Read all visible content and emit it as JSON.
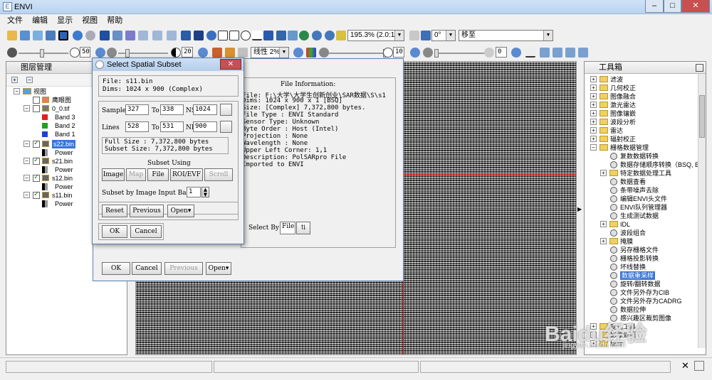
{
  "window": {
    "title": "ENVI",
    "min": "–",
    "max": "□",
    "close": "✕"
  },
  "menu": [
    "文件",
    "编辑",
    "显示",
    "视图",
    "帮助"
  ],
  "toolbar": {
    "zoom": "195.3% (2.0:1)",
    "angle": "0°",
    "mode": "移至",
    "stretch": "线性 2%",
    "v1": "50",
    "v2": "20",
    "v3": "10",
    "v4": "0"
  },
  "layers": {
    "title": "图层管理",
    "root": "视图",
    "overview": "鹰眼图",
    "file1": "0_0.tif",
    "band3": "Band 3",
    "band2": "Band 2",
    "band1": "Band 1",
    "files": [
      {
        "name": "s22.bin",
        "sub": "Power"
      },
      {
        "name": "s21.bin",
        "sub": "Power"
      },
      {
        "name": "s12.bin",
        "sub": "Power"
      },
      {
        "name": "s11.bin",
        "sub": "Power"
      }
    ]
  },
  "fileinfo": {
    "title": "File Information:",
    "lines": [
      "File: F:\\大学\\大学生创新创业\\SAR数据\\S\\s1",
      "Dims: 1024 x 900 x 1 [BSQ]",
      "Size: [Complex] 7,372,800 bytes.",
      "File Type  : ENVI Standard",
      "Sensor Type: Unknown",
      "Byte Order : Host (Intel)",
      "Projection : None",
      "Wavelength : None",
      "Upper Left Corner: 1,1",
      "Description: PolSARpro File",
      "Imported to ENVI"
    ],
    "selectby": "Select By",
    "file": "File",
    "ok": "OK",
    "cancel": "Cancel",
    "previous": "Previous",
    "open": "Open"
  },
  "dialog": {
    "title": "Select Spatial Subset",
    "info1": "File: s11.bin",
    "info2": "Dims: 1024 x 900 (Complex)",
    "samples": "Samples",
    "to": "To",
    "ns": "NS",
    "lines": "Lines",
    "nl": "NL",
    "s_from": "327",
    "s_to": "338",
    "s_ns": "1024",
    "l_from": "528",
    "l_to": "531",
    "l_nl": "900",
    "fullsize": "Full Size  : 7,372,800 bytes",
    "subsize": "Subset Size: 7,372,800 bytes",
    "subsetusing": "Subset Using",
    "image": "Image",
    "map": "Map",
    "file": "File",
    "roi": "ROI/EVF",
    "scroll": "Scroll",
    "byband": "Subset by Image Input Band",
    "band": "1",
    "reset": "Reset",
    "previous": "Previous",
    "open": "Open",
    "ok": "OK",
    "cancel": "Cancel"
  },
  "toolbox": {
    "title": "工具箱",
    "items": [
      {
        "t": "滤波",
        "k": "folder",
        "l": 0
      },
      {
        "t": "几何校正",
        "k": "folder",
        "l": 0
      },
      {
        "t": "图像融合",
        "k": "folder",
        "l": 0
      },
      {
        "t": "激光雷达",
        "k": "folder",
        "l": 0
      },
      {
        "t": "图像镶嵌",
        "k": "folder",
        "l": 0
      },
      {
        "t": "波段分析",
        "k": "folder",
        "l": 0
      },
      {
        "t": "雷达",
        "k": "folder",
        "l": 0
      },
      {
        "t": "辐射校正",
        "k": "folder",
        "l": 0
      },
      {
        "t": "栅格数据管理",
        "k": "folder",
        "l": 0,
        "open": true
      },
      {
        "t": "复数数据转换",
        "k": "tool",
        "l": 1
      },
      {
        "t": "数据存储顺序转换（BSQ, BI",
        "k": "tool",
        "l": 1
      },
      {
        "t": "特定数据处理工具",
        "k": "folder",
        "l": 1
      },
      {
        "t": "数据查看",
        "k": "tool",
        "l": 1
      },
      {
        "t": "条带噪声去除",
        "k": "tool",
        "l": 1
      },
      {
        "t": "编辑ENVI头文件",
        "k": "tool",
        "l": 1
      },
      {
        "t": "ENVI队列管理器",
        "k": "tool",
        "l": 1
      },
      {
        "t": "生成测试数据",
        "k": "tool",
        "l": 1
      },
      {
        "t": "IDL",
        "k": "folder",
        "l": 1
      },
      {
        "t": "波段组合",
        "k": "tool",
        "l": 1
      },
      {
        "t": "掩膜",
        "k": "folder",
        "l": 1
      },
      {
        "t": "另存栅格文件",
        "k": "tool",
        "l": 1
      },
      {
        "t": "栅格投影转换",
        "k": "tool",
        "l": 1
      },
      {
        "t": "坏线替换",
        "k": "tool",
        "l": 1
      },
      {
        "t": "数据重采样",
        "k": "tool",
        "l": 1,
        "sel": true
      },
      {
        "t": "旋转/翻转数据",
        "k": "tool",
        "l": 1
      },
      {
        "t": "文件另外存为CIB",
        "k": "tool",
        "l": 1
      },
      {
        "t": "文件另外存为CADRG",
        "k": "tool",
        "l": 1
      },
      {
        "t": "数据拉伸",
        "k": "tool",
        "l": 1
      },
      {
        "t": "感兴趣区裁剪图像",
        "k": "tool",
        "l": 1
      },
      {
        "t": "变化工具",
        "k": "folder",
        "l": 0
      },
      {
        "t": "影像处理",
        "k": "folder",
        "l": 0
      },
      {
        "t": "统计",
        "k": "folder",
        "l": 0
      }
    ]
  },
  "watermark": "Baidu经验",
  "watermark2": "jingyan.baidu.com"
}
